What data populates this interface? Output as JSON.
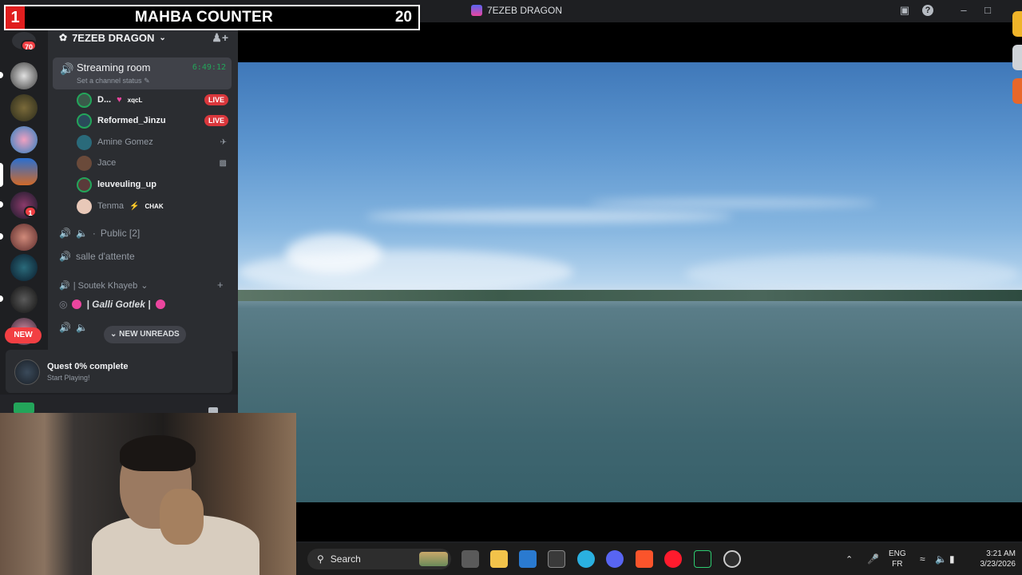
{
  "counter": {
    "left_number": "1",
    "title": "MAHBA COUNTER",
    "right_number": "20"
  },
  "window": {
    "title": "7EZEB DRAGON"
  },
  "rail": {
    "notif_count": "70",
    "server_badge": "1",
    "new_label": "NEW"
  },
  "guild": {
    "name": "7EZEB DRAGON"
  },
  "streaming_room": {
    "name": "Streaming room",
    "timer": "6:49:12",
    "status": "Set a channel status"
  },
  "members": [
    {
      "name": "D...",
      "tag": "xqcL",
      "live": "LIVE"
    },
    {
      "name": "Reformed_Jinzu",
      "live": "LIVE"
    },
    {
      "name": "Amine Gomez"
    },
    {
      "name": "Jace"
    },
    {
      "name": "leuveuling_up"
    },
    {
      "name": "Tenma",
      "tag": "CHAK"
    }
  ],
  "channels": {
    "public": "Public [2]",
    "waiting": "salle d'attente",
    "category": "| Soutek Khayeb",
    "galli": "| Galli Gotlek |"
  },
  "unreads_label": "NEW UNREADS",
  "quest": {
    "title": "Quest 0% complete",
    "subtitle": "Start Playing!"
  },
  "taskbar": {
    "search_placeholder": "Search",
    "lang_top": "ENG",
    "lang_bottom": "FR",
    "time": "3:21 AM",
    "date": "3/23/2026"
  },
  "colors": {
    "accent_green": "#23a55a",
    "live_red": "#da373c",
    "counter_red": "#e01e1e"
  }
}
